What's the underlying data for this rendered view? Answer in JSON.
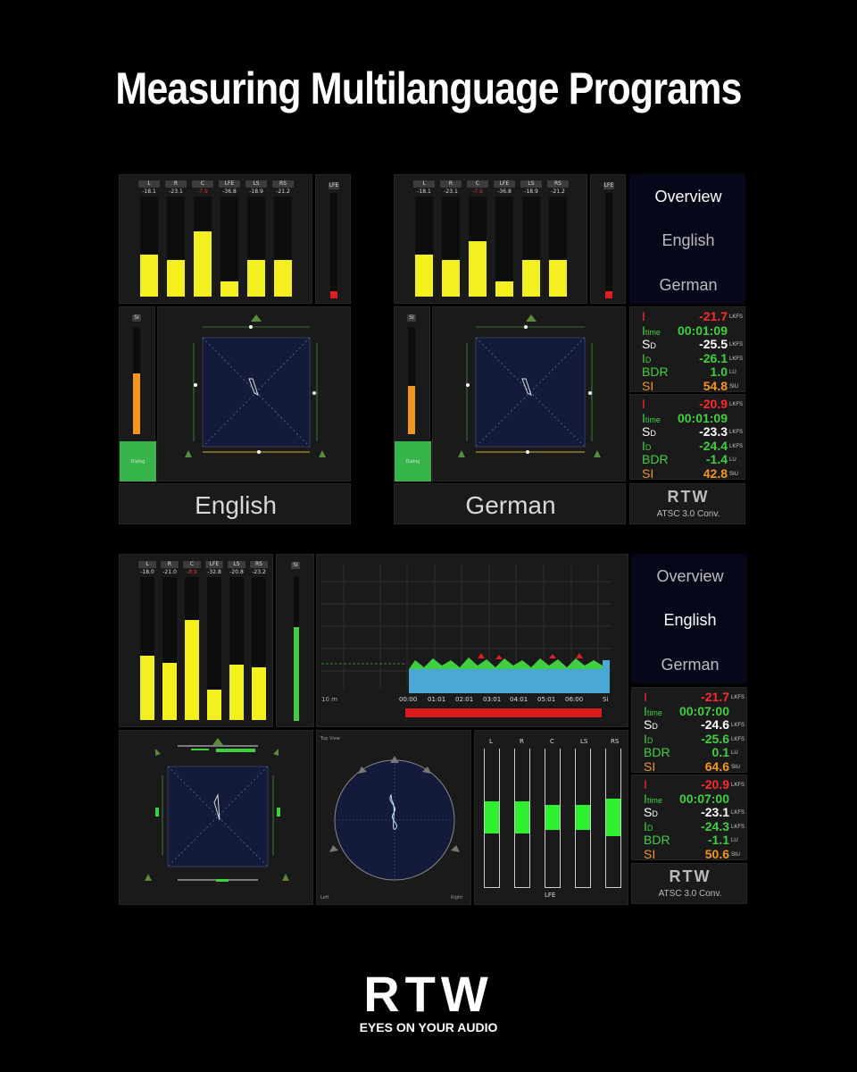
{
  "title": "Measuring Multilanguage Programs",
  "channels": [
    "L",
    "R",
    "C",
    "LFE",
    "LS",
    "RS"
  ],
  "top_left": {
    "values": [
      "-18.1",
      "-23.1",
      "-7.9",
      "-36.8",
      "-18.9",
      "-21.2"
    ],
    "levels": [
      0.42,
      0.37,
      0.65,
      0.15,
      0.37,
      0.37
    ],
    "label": "English",
    "si_level": 0.58,
    "button": "Dialog"
  },
  "top_right": {
    "values": [
      "-18.1",
      "-23.1",
      "-7.9",
      "-36.8",
      "-18.9",
      "-21.2"
    ],
    "levels": [
      0.42,
      0.37,
      0.55,
      0.15,
      0.37,
      0.37
    ],
    "label": "German",
    "si_level": 0.43,
    "button": "Dialog",
    "menu": [
      "Overview",
      "English",
      "German"
    ],
    "stats": [
      {
        "I": "-21.7",
        "Itime": "00:01:09",
        "SD": "-25.5",
        "ID": "-26.1",
        "BDR": "1.0",
        "SI": "54.8"
      },
      {
        "I": "-20.9",
        "Itime": "00:01:09",
        "SD": "-23.3",
        "ID": "-24.4",
        "BDR": "-1.4",
        "SI": "42.8"
      }
    ],
    "logo": "RTW",
    "device": "ATSC 3.0 Conv."
  },
  "bottom": {
    "values": [
      "-18.0",
      "-21.0",
      "-8.9",
      "-32.8",
      "-20.8",
      "-23.2"
    ],
    "levels": [
      0.45,
      0.4,
      0.7,
      0.21,
      0.39,
      0.37
    ],
    "si_level": 0.66,
    "timeline": [
      "10 m",
      "00:00",
      "01:01",
      "02:01",
      "03:01",
      "04:01",
      "05:01",
      "06:00",
      "Si"
    ],
    "menu": [
      "Overview",
      "English",
      "German"
    ],
    "stats": [
      {
        "I": "-21.7",
        "Itime": "00:07:00",
        "SD": "-24.6",
        "ID": "-25.6",
        "BDR": "0.1",
        "SI": "64.6"
      },
      {
        "I": "-20.9",
        "Itime": "00:07:00",
        "SD": "-23.1",
        "ID": "-24.3",
        "BDR": "-1.1",
        "SI": "50.6"
      }
    ],
    "logo": "RTW",
    "device": "ATSC 3.0 Conv.",
    "mic_channels": [
      "L",
      "R",
      "C",
      "LS",
      "RS"
    ],
    "mic_footer": "LFE",
    "topview_label": "Top View",
    "left_label": "Left",
    "right_label": "Right"
  },
  "stat_labels": [
    "I",
    "Itime",
    "SD",
    "ID",
    "BDR",
    "SI"
  ],
  "stat_units": [
    "LKFS",
    "",
    "LKFS",
    "LKFS",
    "LU",
    "SIU"
  ],
  "footer": {
    "logo": "RTW",
    "tagline": "EYES ON YOUR AUDIO"
  },
  "colors": {
    "bar": "#f4ef1e",
    "green": "#3fcf3f",
    "red": "#ff2a2a",
    "orange": "#f29620",
    "water": "#4aa7d6"
  }
}
